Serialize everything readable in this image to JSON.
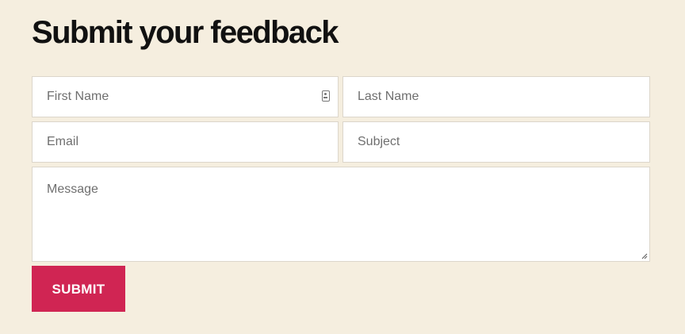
{
  "form": {
    "title": "Submit your feedback",
    "fields": {
      "first_name": {
        "placeholder": "First Name",
        "icon": "contact-card-icon"
      },
      "last_name": {
        "placeholder": "Last Name"
      },
      "email": {
        "placeholder": "Email"
      },
      "subject": {
        "placeholder": "Subject"
      },
      "message": {
        "placeholder": "Message"
      }
    },
    "submit_label": "SUBMIT"
  },
  "colors": {
    "background": "#f5eedf",
    "field_background": "#ffffff",
    "field_border": "#dcd6cb",
    "accent": "#d02553",
    "title_text": "#111111",
    "placeholder_text": "#6f6f6f"
  }
}
